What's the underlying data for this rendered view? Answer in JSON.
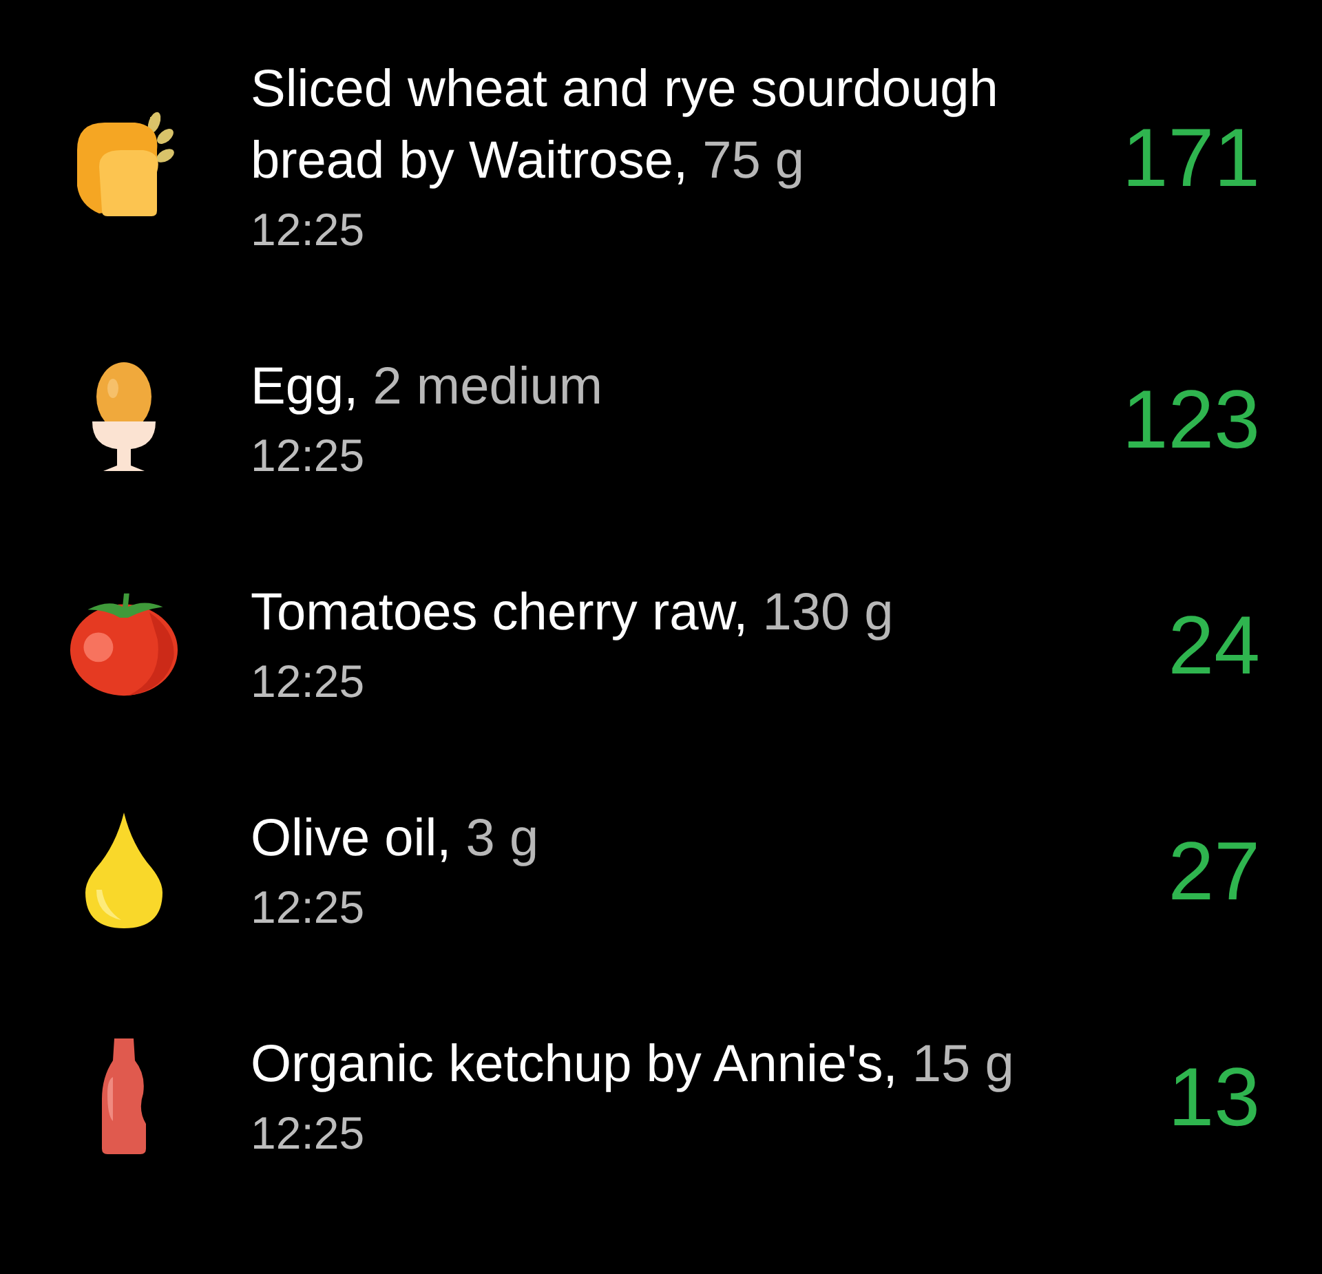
{
  "entries": [
    {
      "kind": "bread",
      "name": "Sliced wheat and rye sourdough bread by Waitrose,",
      "amount": "75 g",
      "time": "12:25",
      "calories": "171"
    },
    {
      "kind": "egg",
      "name": "Egg,",
      "amount": "2 medium",
      "time": "12:25",
      "calories": "123"
    },
    {
      "kind": "tomato",
      "name": "Tomatoes cherry raw,",
      "amount": "130 g",
      "time": "12:25",
      "calories": "24"
    },
    {
      "kind": "oil",
      "name": "Olive oil,",
      "amount": "3 g",
      "time": "12:25",
      "calories": "27"
    },
    {
      "kind": "ketchup",
      "name": "Organic ketchup by Annie's,",
      "amount": "15 g",
      "time": "12:25",
      "calories": "13"
    }
  ]
}
